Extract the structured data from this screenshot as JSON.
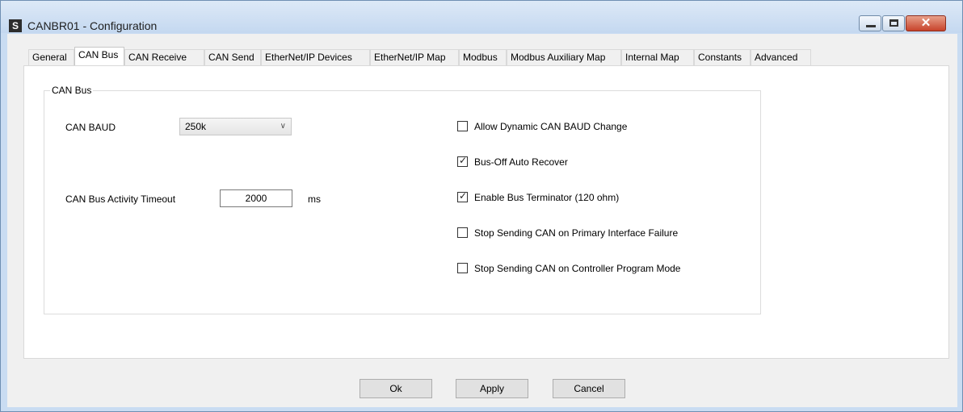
{
  "window": {
    "app_icon": "S",
    "title": "CANBR01 - Configuration",
    "controls": {
      "minimize": "minimize-icon",
      "maximize": "maximize-icon",
      "close": "close-icon"
    }
  },
  "tabs": [
    {
      "label": "General"
    },
    {
      "label": "CAN Bus"
    },
    {
      "label": "CAN Receive"
    },
    {
      "label": "CAN Send"
    },
    {
      "label": "EtherNet/IP Devices"
    },
    {
      "label": "EtherNet/IP Map"
    },
    {
      "label": "Modbus"
    },
    {
      "label": "Modbus Auxiliary Map"
    },
    {
      "label": "Internal Map"
    },
    {
      "label": "Constants"
    },
    {
      "label": "Advanced"
    }
  ],
  "active_tab": "CAN Bus",
  "group": {
    "title": "CAN Bus",
    "baud_label": "CAN BAUD",
    "baud_value": "250k",
    "timeout_label": "CAN Bus Activity Timeout",
    "timeout_value": "2000",
    "timeout_unit": "ms",
    "checkboxes": [
      {
        "label": "Allow Dynamic CAN BAUD Change",
        "checked": false
      },
      {
        "label": "Bus-Off Auto Recover",
        "checked": true
      },
      {
        "label": "Enable Bus Terminator (120 ohm)",
        "checked": true
      },
      {
        "label": "Stop Sending CAN on Primary Interface Failure",
        "checked": false
      },
      {
        "label": "Stop Sending CAN on Controller Program Mode",
        "checked": false
      }
    ]
  },
  "buttons": {
    "ok": "Ok",
    "apply": "Apply",
    "cancel": "Cancel"
  }
}
